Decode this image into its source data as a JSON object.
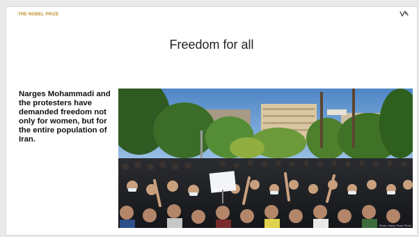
{
  "slide": {
    "brand": "THE NOBEL PRIZE",
    "title": "Freedom for all",
    "body_text": "Narges Mohammadi and the protesters have demanded freedom not only for women, but for the entire population of Iran.",
    "corner_icon": "slide-logo-icon"
  },
  "photo": {
    "subject": "protest-crowd-photo",
    "credit": "Photo: Alamy Stock Photo"
  },
  "colors": {
    "brand": "#b98a1e",
    "title": "#222222",
    "text": "#111111",
    "background": "#ffffff"
  }
}
